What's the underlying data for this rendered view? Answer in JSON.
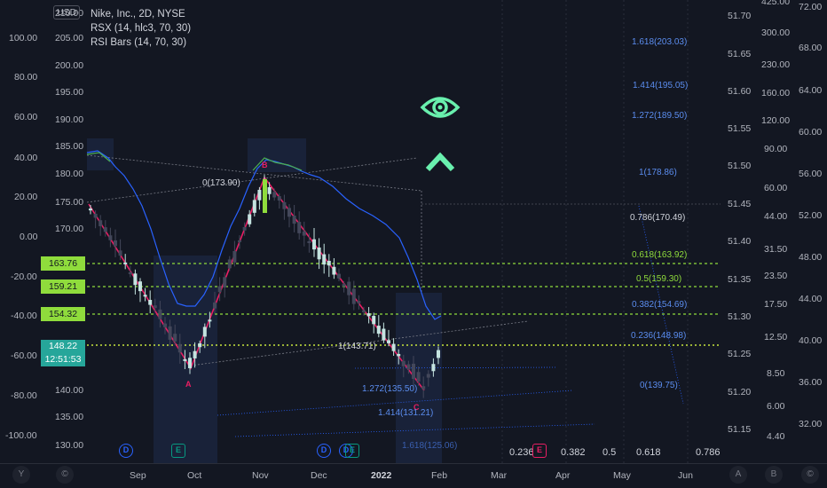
{
  "header": {
    "currency": "USD",
    "symbol": "Nike, Inc., 2D, NYSE",
    "indicator1": "RSX (14, hlc3, 70, 30)",
    "indicator2": "RSI Bars (14, 70, 30)"
  },
  "rsx_axis": [
    "100.00",
    "80.00",
    "60.00",
    "40.00",
    "20.00",
    "0.00",
    "-20.00",
    "-40.00",
    "-60.00",
    "-80.00",
    "-100.00"
  ],
  "price_axis": [
    "210.00",
    "205.00",
    "200.00",
    "195.00",
    "190.00",
    "185.00",
    "180.00",
    "175.00",
    "170.00",
    "140.00",
    "135.00",
    "130.00"
  ],
  "right_axis1": [
    "51.70",
    "51.65",
    "51.60",
    "51.55",
    "51.50",
    "51.45",
    "51.40",
    "51.35",
    "51.30",
    "51.25",
    "51.20",
    "51.15"
  ],
  "right_axis2": [
    "425.00",
    "300.00",
    "230.00",
    "160.00",
    "120.00",
    "90.00",
    "60.00",
    "44.00",
    "31.50",
    "23.50",
    "17.50",
    "12.50",
    "8.50",
    "6.00",
    "4.40"
  ],
  "right_axis3": [
    "72.00",
    "68.00",
    "64.00",
    "60.00",
    "56.00",
    "52.00",
    "48.00",
    "44.00",
    "40.00",
    "36.00",
    "32.00"
  ],
  "price_tags": [
    "163.76",
    "159.21",
    "154.32"
  ],
  "current_price": {
    "price": "148.22",
    "countdown": "12:51:53"
  },
  "months": [
    "Sep",
    "Oct",
    "Nov",
    "Dec",
    "2022",
    "Feb",
    "Mar",
    "Apr",
    "May",
    "Jun"
  ],
  "bottom_buttons": [
    "Y",
    "©",
    "A",
    "B",
    "©"
  ],
  "fib_bottom": [
    "0.236",
    "0.382",
    "0.5",
    "0.618",
    "0.786"
  ],
  "events": [
    {
      "t": "D"
    },
    {
      "t": "E"
    },
    {
      "t": "D"
    },
    {
      "t": "D"
    },
    {
      "t": "E"
    },
    {
      "t": "E"
    }
  ],
  "fib_right": [
    "1.618(203.03)",
    "1.414(195.05)",
    "1.272(189.50)",
    "1(178.86)",
    "0.786(170.49)",
    "0.618(163.92)",
    "0.5(159.30)",
    "0.382(154.69)",
    "0.236(148.98)",
    "0(139.75)"
  ],
  "fib_left": [
    "0(173.90)",
    "1(143.71)",
    "1.272(135.50)",
    "1.414(131.21)",
    "1.618(125.06)"
  ],
  "points": {
    "a": "A",
    "b": "B",
    "c": "C"
  },
  "colors": {
    "bg": "#131722",
    "bull": "#26a69a",
    "bear": "#ef5350",
    "fib_green": "#8fdc3c",
    "fib_blue": "#2962ff",
    "pattern": "#e91e63",
    "eye": "#69f0ae"
  },
  "icons": {
    "eye": "eye-icon",
    "up": "chevron-up-icon"
  }
}
